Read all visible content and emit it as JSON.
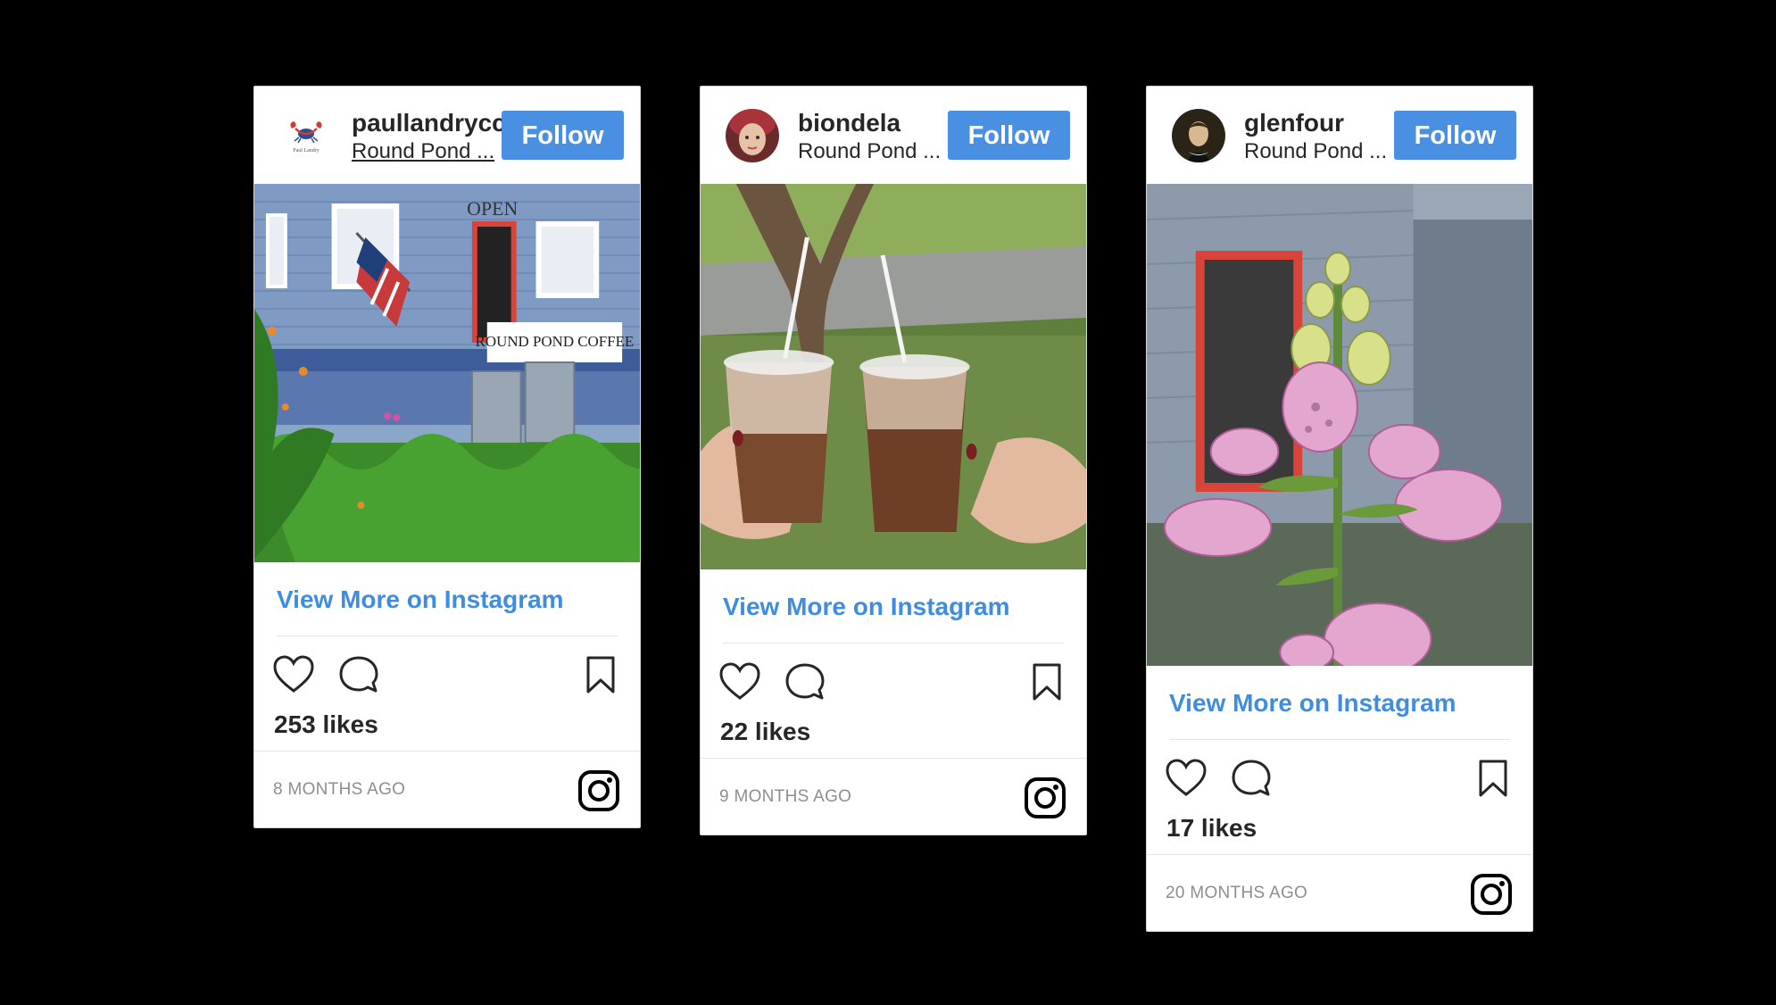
{
  "cards": [
    {
      "username": "paullandrycc",
      "location": "Round Pond ...",
      "follow_label": "Follow",
      "avatar_icon": "lobster-logo",
      "photo_alt": "Round Pond Coffee storefront with flag and Adirondack chairs",
      "view_more": "View More on Instagram",
      "likes": "253 likes",
      "timestamp": "8 MONTHS AGO"
    },
    {
      "username": "biondela",
      "location": "Round Pond ...",
      "follow_label": "Follow",
      "avatar_icon": "profile-photo",
      "photo_alt": "Two iced coffees held up in a toast",
      "view_more": "View More on Instagram",
      "likes": "22 likes",
      "timestamp": "9 MONTHS AGO"
    },
    {
      "username": "glenfour",
      "location": "Round Pond ...",
      "follow_label": "Follow",
      "avatar_icon": "profile-photo",
      "photo_alt": "Pink foxglove flower in front of the coffee shop",
      "view_more": "View More on Instagram",
      "likes": "17 likes",
      "timestamp": "20 MONTHS AGO"
    }
  ],
  "colors": {
    "follow_button": "#4a90e2",
    "link": "#3f8de0",
    "background": "#000000",
    "muted_text": "#8e8e8e"
  },
  "icons": {
    "like": "heart-icon",
    "comment": "comment-icon",
    "save": "bookmark-icon",
    "brand": "instagram-icon"
  }
}
